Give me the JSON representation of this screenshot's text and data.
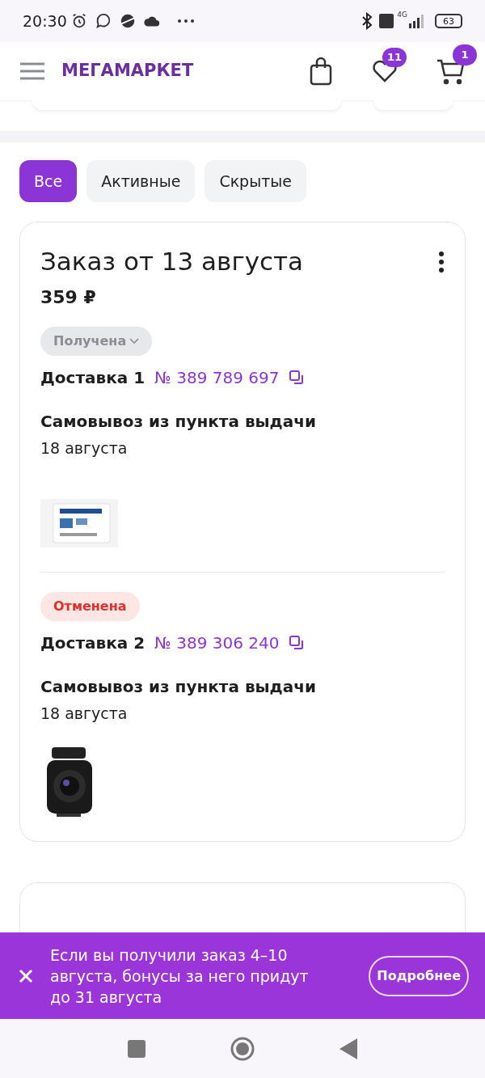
{
  "status_bar": {
    "time": "20:30",
    "battery": "63",
    "network": "4G"
  },
  "header": {
    "logo": "МЕГАМАРКЕТ",
    "favorites_badge": "11",
    "cart_badge": "1"
  },
  "filters": [
    {
      "label": "Все",
      "selected": true
    },
    {
      "label": "Активные",
      "selected": false
    },
    {
      "label": "Скрытые",
      "selected": false
    }
  ],
  "order": {
    "title": "Заказ от 13 августа",
    "total": "359 ₽",
    "deliveries": [
      {
        "status": "Получена",
        "kind": "received",
        "expandable": true,
        "title": "Доставка 1",
        "number": "№ 389 789 697",
        "method": "Самовывоз из пункта выдачи",
        "date": "18 августа",
        "product": {
          "kind": "sdcard"
        }
      },
      {
        "status": "Отменена",
        "kind": "cancelled",
        "expandable": false,
        "title": "Доставка 2",
        "number": "№ 389 306 240",
        "method": "Самовывоз из пункта выдачи",
        "date": "18 августа",
        "product": {
          "kind": "camera"
        }
      }
    ]
  },
  "banner": {
    "text": "Если вы получили заказ 4–10 августа, бонусы за него придут до 31 августа",
    "button": "Подробнее"
  }
}
